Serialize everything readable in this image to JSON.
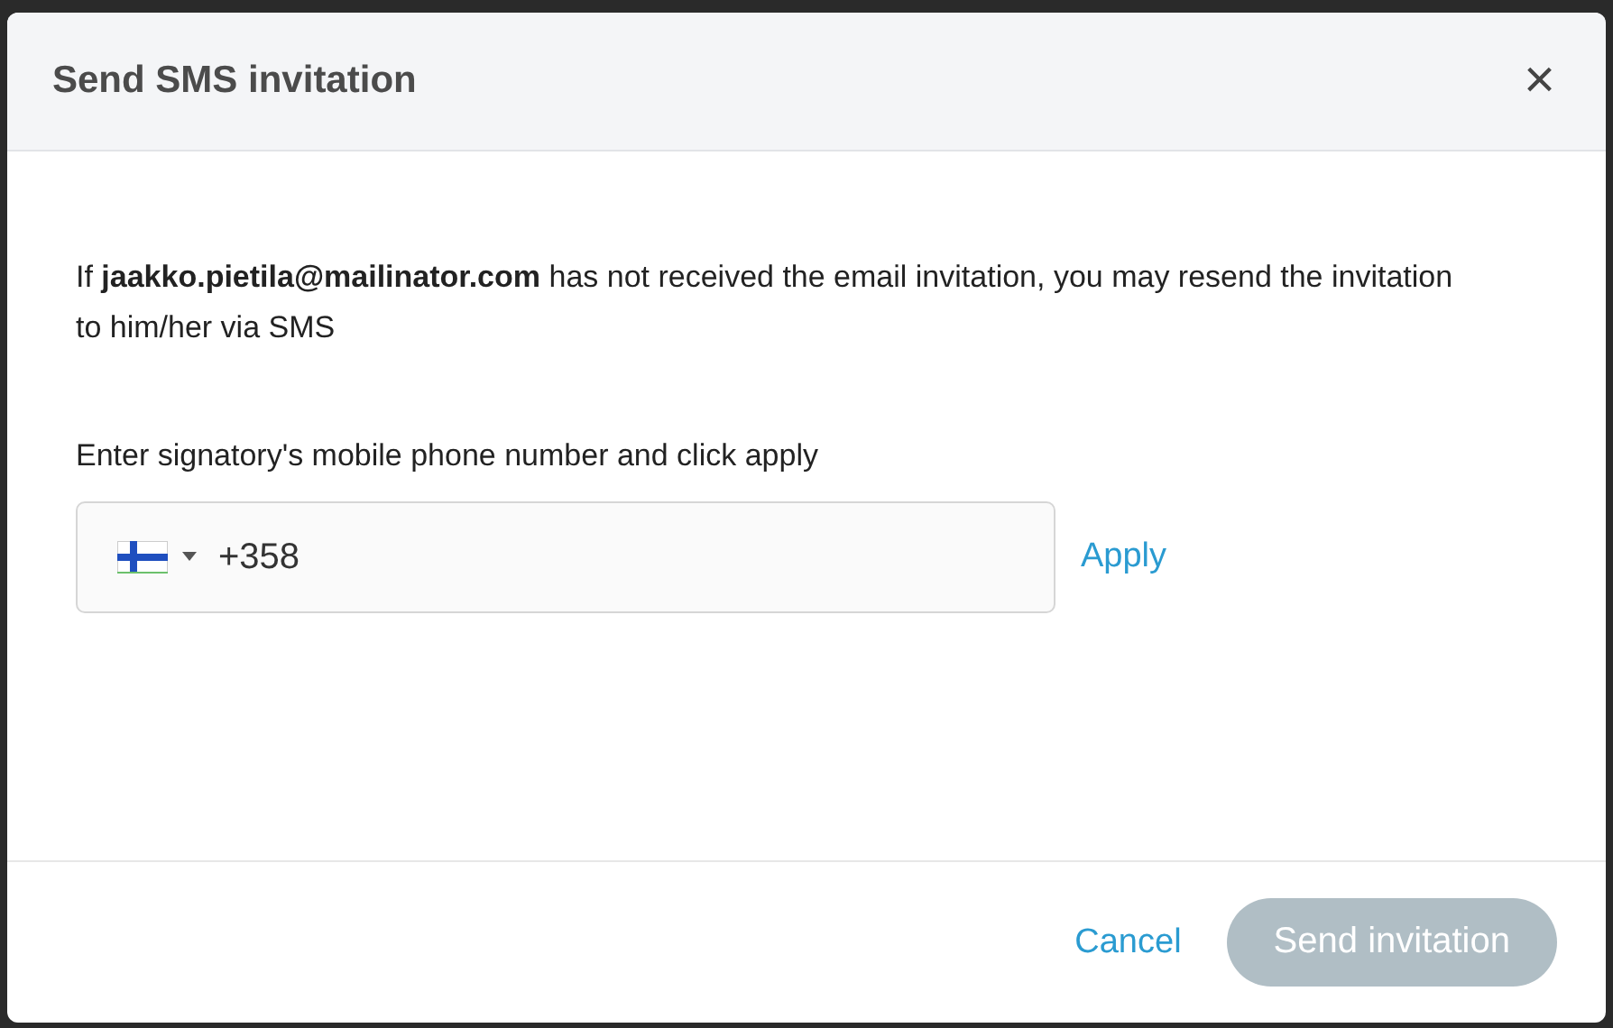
{
  "dialog": {
    "title": "Send SMS invitation",
    "close": "×"
  },
  "message": "If **jaakko.pietila@mailinator.com** has not received the email invitation, you may resend the invitation to him/her via SMS",
  "phone": {
    "label": "Enter signatory's mobile phone number and click apply",
    "value": "+358",
    "apply": "Apply"
  },
  "buttons": [
    {
      "kind": "link",
      "label": "Cancel",
      "disabled": false
    },
    {
      "kind": "primary",
      "label": "Send invitation",
      "disabled": true
    }
  ]
}
